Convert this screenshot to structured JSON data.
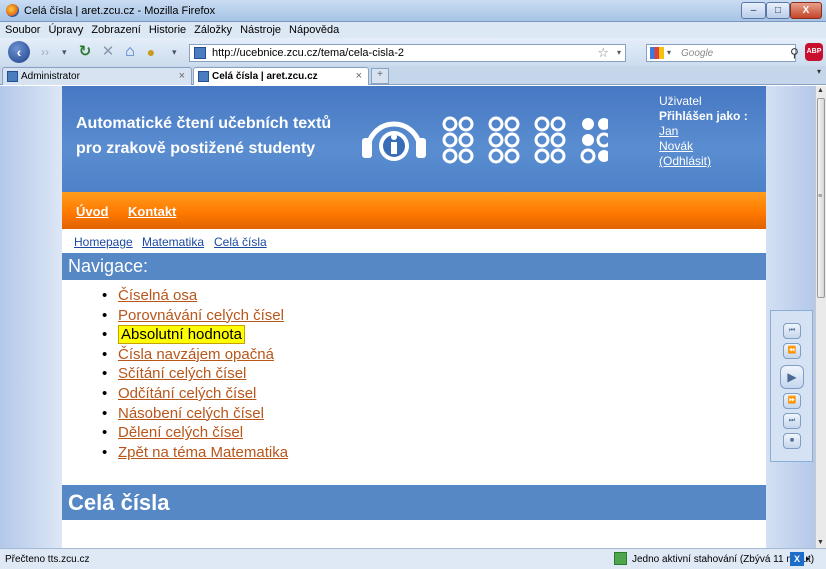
{
  "window": {
    "title": "Celá čísla | aret.zcu.cz - Mozilla Firefox",
    "minimize_glyph": "–",
    "maximize_glyph": "□",
    "close_glyph": "X"
  },
  "menu": {
    "items": [
      "Soubor",
      "Úpravy",
      "Zobrazení",
      "Historie",
      "Záložky",
      "Nástroje",
      "Nápověda"
    ]
  },
  "toolbar": {
    "url": "http://ucebnice.zcu.cz/tema/cela-cisla-2",
    "search_placeholder": "Google",
    "abp_label": "ABP"
  },
  "tabs": [
    {
      "label": "Administrator",
      "active": false
    },
    {
      "label": "Celá čísla | aret.zcu.cz",
      "active": true
    }
  ],
  "site": {
    "tagline_line1": "Automatické čtení učebních textů",
    "tagline_line2": "pro zrakově postižené studenty",
    "user": {
      "label": "Uživatel",
      "logged_in_as": "Přihlášen jako :",
      "first_name": "Jan",
      "last_name": "Novák",
      "logout": "(Odhlásit)"
    },
    "topnav": [
      "Úvod",
      "Kontakt"
    ],
    "breadcrumb": [
      "Homepage",
      "Matematika",
      "Celá čísla"
    ],
    "nav_heading": "Navigace:",
    "nav_items": [
      "Číselná osa",
      "Porovnávání celých čísel",
      "Absolutní hodnota",
      "Čísla navzájem opačná",
      "Sčítání celých čísel",
      "Odčítání celých čísel",
      "Násobení celých čísel",
      "Dělení celých čísel",
      "Zpět na téma Matematika"
    ],
    "highlighted_item": "Absolutní hodnota",
    "page_title": "Celá čísla"
  },
  "player": {
    "buttons": [
      "⏮",
      "⏪",
      "▶",
      "⏩",
      "⏭",
      "■"
    ]
  },
  "status": {
    "left": "Přečteno tts.zcu.cz",
    "right": "Jedno aktivní stahování (Zbývá 11 minut)"
  },
  "colors": {
    "header_blue": "#4d82c8",
    "nav_orange": "#ff7a00",
    "section_blue": "#5588c4",
    "link_brown": "#b8561a",
    "highlight": "#ffff00"
  }
}
